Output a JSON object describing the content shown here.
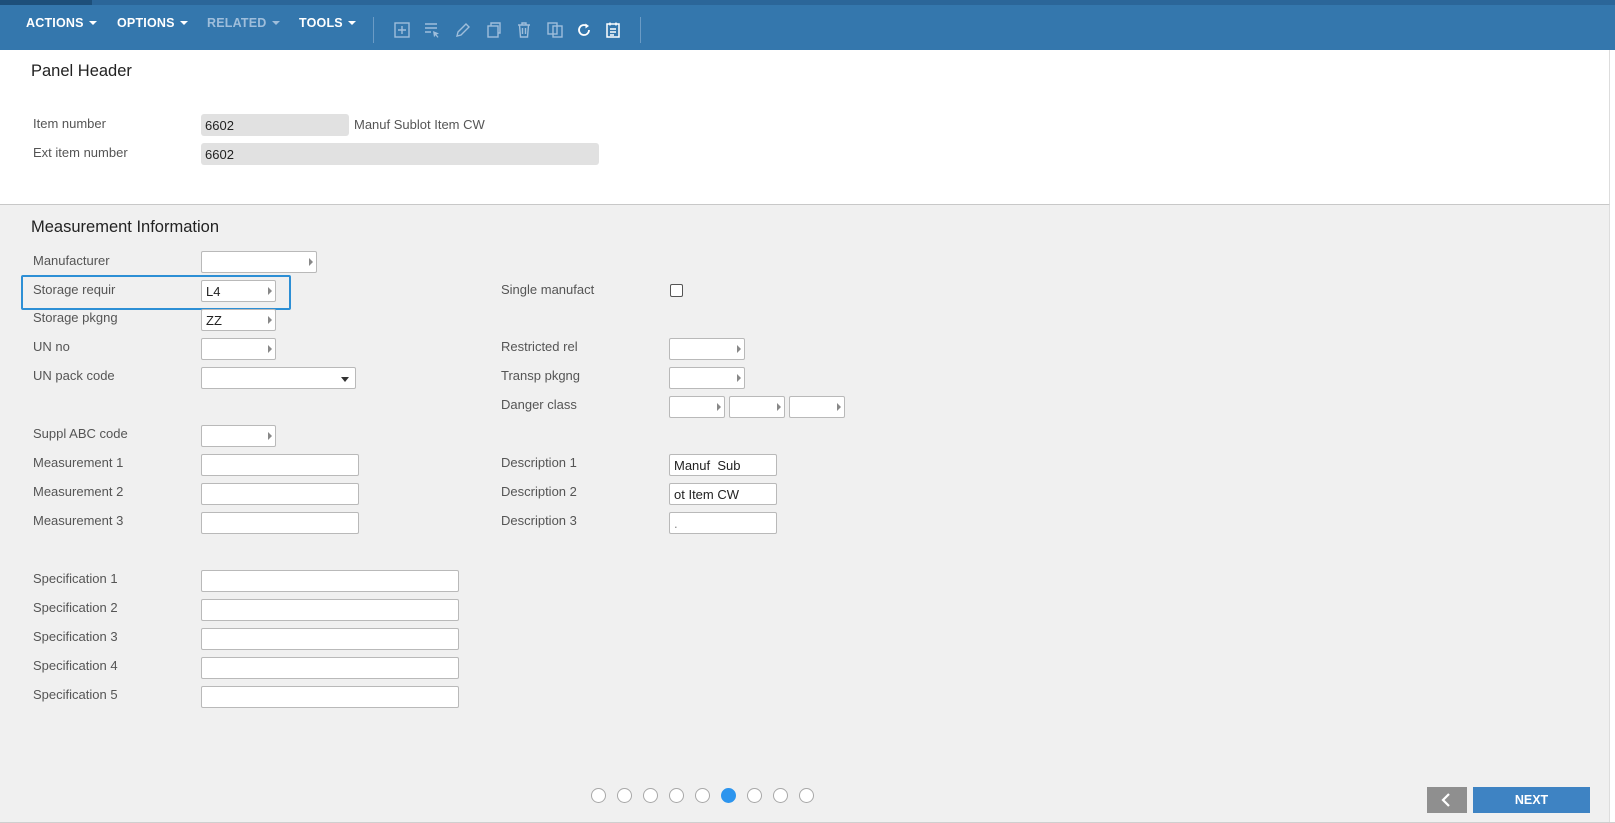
{
  "toolbar": {
    "menus": {
      "actions": "ACTIONS",
      "options": "OPTIONS",
      "related": "RELATED",
      "tools": "TOOLS"
    },
    "icons": [
      "add-icon",
      "select-icon",
      "edit-icon",
      "copy-icon",
      "delete-icon",
      "duplicate-icon",
      "refresh-icon",
      "notes-icon"
    ]
  },
  "panel_header": {
    "title": "Panel Header",
    "item_number": {
      "label": "Item number",
      "value": "6602",
      "description": "Manuf Sublot Item CW"
    },
    "ext_item_number": {
      "label": "Ext item number",
      "value": "6602"
    }
  },
  "measurement": {
    "title": "Measurement Information",
    "manufacturer": {
      "label": "Manufacturer",
      "value": ""
    },
    "storage_requir": {
      "label": "Storage requir",
      "value": "L4"
    },
    "storage_pkgng": {
      "label": "Storage pkgng",
      "value": "ZZ"
    },
    "un_no": {
      "label": "UN no",
      "value": ""
    },
    "un_pack_code": {
      "label": "UN pack code",
      "value": ""
    },
    "suppl_abc_code": {
      "label": "Suppl ABC code",
      "value": ""
    },
    "measurement_1": {
      "label": "Measurement 1",
      "value": ""
    },
    "measurement_2": {
      "label": "Measurement 2",
      "value": ""
    },
    "measurement_3": {
      "label": "Measurement 3",
      "value": ""
    },
    "specification_1": {
      "label": "Specification 1",
      "value": ""
    },
    "specification_2": {
      "label": "Specification 2",
      "value": ""
    },
    "specification_3": {
      "label": "Specification 3",
      "value": ""
    },
    "specification_4": {
      "label": "Specification 4",
      "value": ""
    },
    "specification_5": {
      "label": "Specification 5",
      "value": ""
    },
    "single_manufact": {
      "label": "Single manufact",
      "checked": false
    },
    "restricted_rel": {
      "label": "Restricted rel",
      "value": ""
    },
    "transp_pkgng": {
      "label": "Transp pkgng",
      "value": ""
    },
    "danger_class": {
      "label": "Danger class",
      "values": [
        "",
        "",
        ""
      ]
    },
    "description_1": {
      "label": "Description 1",
      "value": "Manuf  Sub"
    },
    "description_2": {
      "label": "Description 2",
      "value": "ot Item CW"
    },
    "description_3": {
      "label": "Description 3",
      "value": "."
    }
  },
  "pager": {
    "total": 9,
    "active_index": 5
  },
  "buttons": {
    "next": "NEXT"
  },
  "colors": {
    "toolbar": "#3477ad",
    "accent": "#2d95ee",
    "next_button": "#3e83c3"
  }
}
